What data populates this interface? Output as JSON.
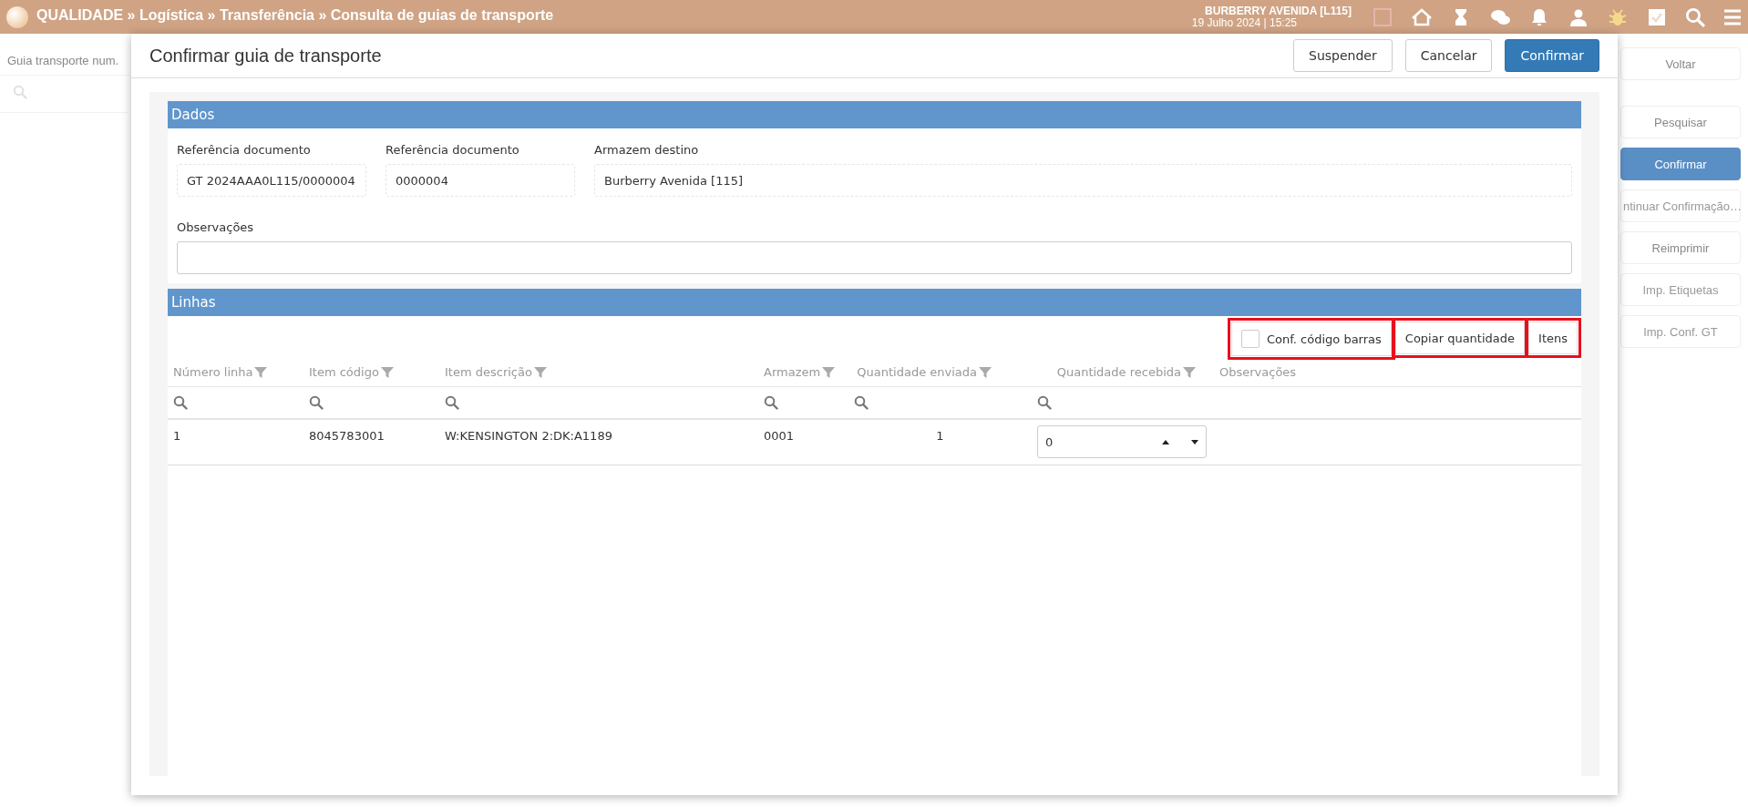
{
  "top_bar": {
    "breadcrumb": "QUALIDADE » Logística » Transferência » Consulta de guias de transporte",
    "datetime": "19 Julho 2024 | 15:25",
    "location": "BURBERRY AVENIDA [L115]"
  },
  "background_list": {
    "column": "Guia transporte num."
  },
  "sidebar": {
    "items": [
      {
        "label": "Voltar",
        "selected": false,
        "disabled": false
      },
      {
        "label": "Pesquisar",
        "selected": false,
        "disabled": false
      },
      {
        "label": "Confirmar",
        "selected": true,
        "disabled": false
      },
      {
        "label": "ntinuar Confirmação…",
        "selected": false,
        "disabled": true
      },
      {
        "label": "Reimprimir",
        "selected": false,
        "disabled": false
      },
      {
        "label": "Imp. Etiquetas",
        "selected": false,
        "disabled": true
      },
      {
        "label": "Imp. Conf. GT",
        "selected": false,
        "disabled": true
      }
    ]
  },
  "dialog": {
    "title": "Confirmar guia de transporte",
    "buttons": [
      {
        "label": "Suspender",
        "kind": "default"
      },
      {
        "label": "Cancelar",
        "kind": "default"
      },
      {
        "label": "Confirmar",
        "kind": "primary"
      }
    ],
    "dados": {
      "title": "Dados",
      "fields": [
        {
          "label": "Referência documento",
          "value": "GT 2024AAA0L115/0000004"
        },
        {
          "label": "Referência documento",
          "value": "0000004"
        },
        {
          "label": "Armazem destino",
          "value": "Burberry Avenida [115]"
        }
      ],
      "notes": {
        "label": "Observações"
      }
    },
    "linhas": {
      "title": "Linhas",
      "toolbar": [
        {
          "kind": "checkbox",
          "label": "Conf. código barras",
          "checked": false,
          "highlighted": true
        },
        {
          "kind": "button",
          "label": "Copiar quantidade",
          "highlighted": true
        },
        {
          "kind": "button",
          "label": "Itens",
          "highlighted": true
        }
      ],
      "table": {
        "columns": [
          {
            "label": "Número linha",
            "filter": true,
            "kind": "text"
          },
          {
            "label": "Item código",
            "filter": true,
            "kind": "text"
          },
          {
            "label": "Item descrição",
            "filter": true,
            "kind": "text"
          },
          {
            "label": "Armazem",
            "filter": true,
            "kind": "text"
          },
          {
            "label": "Quantidade enviada",
            "filter": true,
            "kind": "numeric"
          },
          {
            "label": "Quantidade recebida",
            "filter": true,
            "kind": "numeric"
          },
          {
            "label": "Observações",
            "filter": false,
            "kind": "text"
          }
        ],
        "rows": [
          {
            "cells": [
              "1",
              "8045783001",
              "W:KENSINGTON 2:DK:A1189",
              "0001",
              "1"
            ],
            "received": "0"
          }
        ]
      }
    }
  }
}
